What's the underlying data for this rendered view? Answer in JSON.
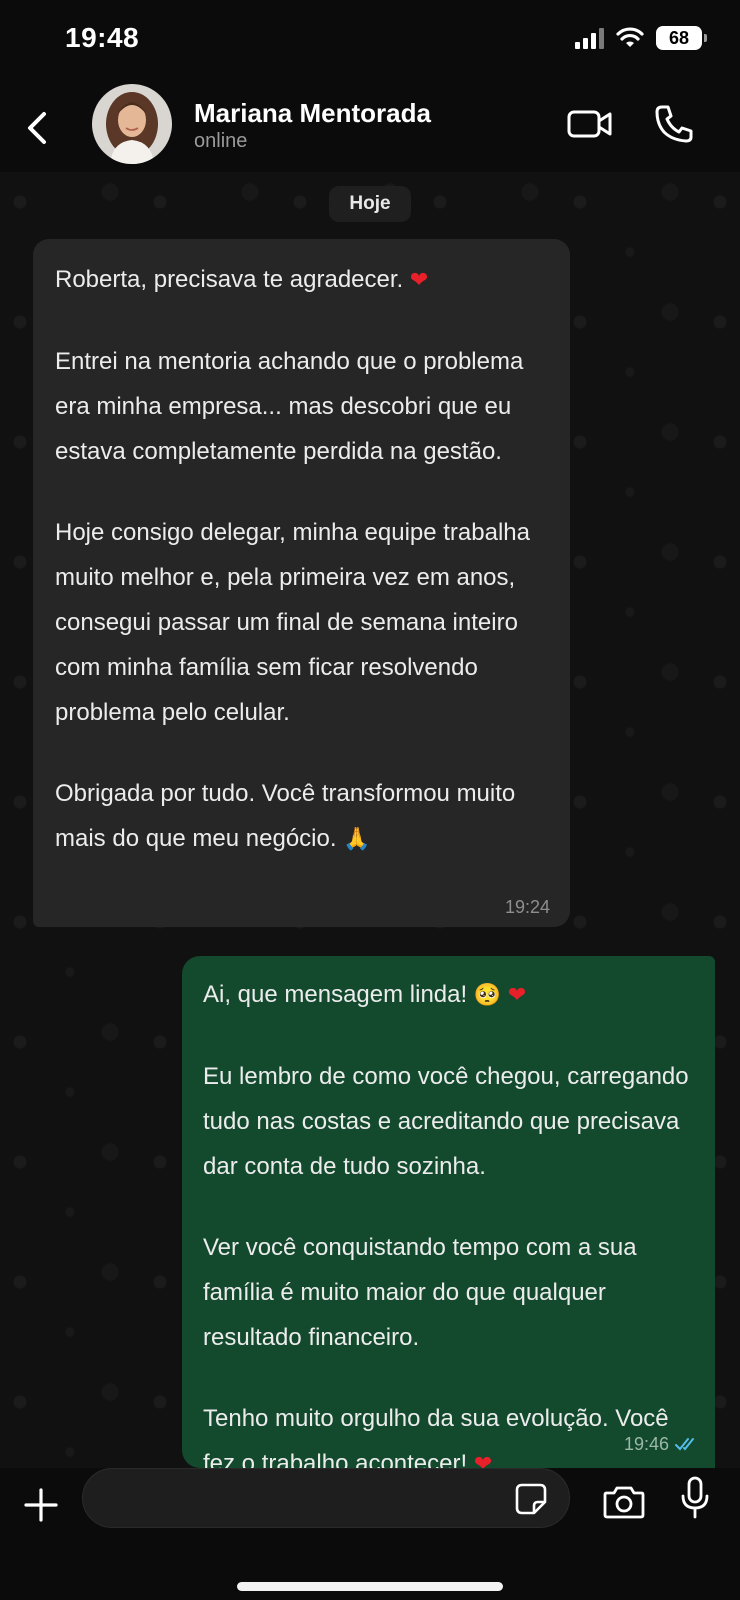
{
  "status_bar": {
    "time": "19:48",
    "battery": "68"
  },
  "header": {
    "contact_name": "Mariana Mentorada",
    "contact_status": "online"
  },
  "chat": {
    "date_chip": "Hoje",
    "incoming": {
      "p1": "Roberta, precisava te agradecer.",
      "p2": "Entrei na mentoria achando que o problema era minha empresa... mas descobri que eu estava completamente perdida na gestão.",
      "p3": "Hoje consigo delegar, minha equipe trabalha muito melhor e, pela primeira vez em anos, consegui passar um final de semana inteiro com minha família sem ficar resolvendo problema pelo celular.",
      "p4": "Obrigada por tudo. Você transformou muito mais do que meu negócio.",
      "time": "19:24"
    },
    "outgoing": {
      "p1": "Ai, que mensagem linda!",
      "p2": "Eu lembro de como você chegou, carregando tudo nas costas e acreditando que precisava dar conta de tudo sozinha.",
      "p3": "Ver você conquistando tempo com a sua família é muito maior do que qualquer resultado financeiro.",
      "p4": "Tenho muito orgulho da sua evolução. Você fez o trabalho acontecer!",
      "time": "19:46",
      "read_status": "double-check-read"
    }
  },
  "composer": {
    "input_value": ""
  },
  "colors": {
    "incoming_bubble": "#262626",
    "outgoing_bubble": "#134a2e",
    "read_ticks": "#53bdeb",
    "heart": "#e8202a"
  }
}
